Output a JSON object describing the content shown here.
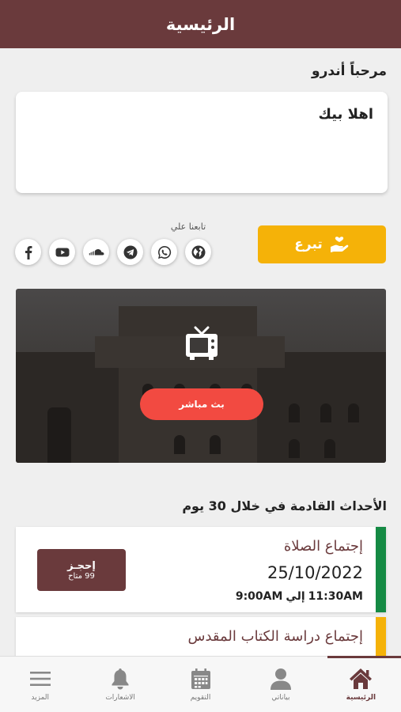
{
  "header": {
    "title": "الرئيسية"
  },
  "greeting": "مرحباً أندرو",
  "welcome": {
    "text": "اهلا بيك"
  },
  "donate": {
    "label": "تبرع"
  },
  "follow": {
    "label": "تابعنا علي",
    "icons": [
      "globe-icon",
      "whatsapp-icon",
      "telegram-icon",
      "soundcloud-icon",
      "youtube-icon",
      "facebook-icon"
    ]
  },
  "live": {
    "label": "بث مباشر"
  },
  "events": {
    "title": "الأحداث القادمة في خلال 30 يوم",
    "items": [
      {
        "title": "إجتماع الصلاة",
        "date": "25/10/2022",
        "time_from": "11:30AM",
        "time_sep": "إلي",
        "time_to": "9:00AM",
        "book_label": "إحجـز",
        "book_count": "99 متاح",
        "color": "#158a44"
      },
      {
        "title": "إجتماع دراسة الكتاب المقدس",
        "color": "#f5b208"
      }
    ]
  },
  "nav": {
    "items": [
      {
        "label": "الرئيسية",
        "icon": "home-icon",
        "active": true
      },
      {
        "label": "بياناتي",
        "icon": "user-icon",
        "active": false
      },
      {
        "label": "التقويم",
        "icon": "calendar-icon",
        "active": false
      },
      {
        "label": "الاشعارات",
        "icon": "bell-icon",
        "active": false
      },
      {
        "label": "المزيد",
        "icon": "menu-icon",
        "active": false
      }
    ]
  },
  "colors": {
    "primary": "#6a3a3c",
    "accent": "#f5b208",
    "live": "#f24a41",
    "success": "#158a44"
  }
}
